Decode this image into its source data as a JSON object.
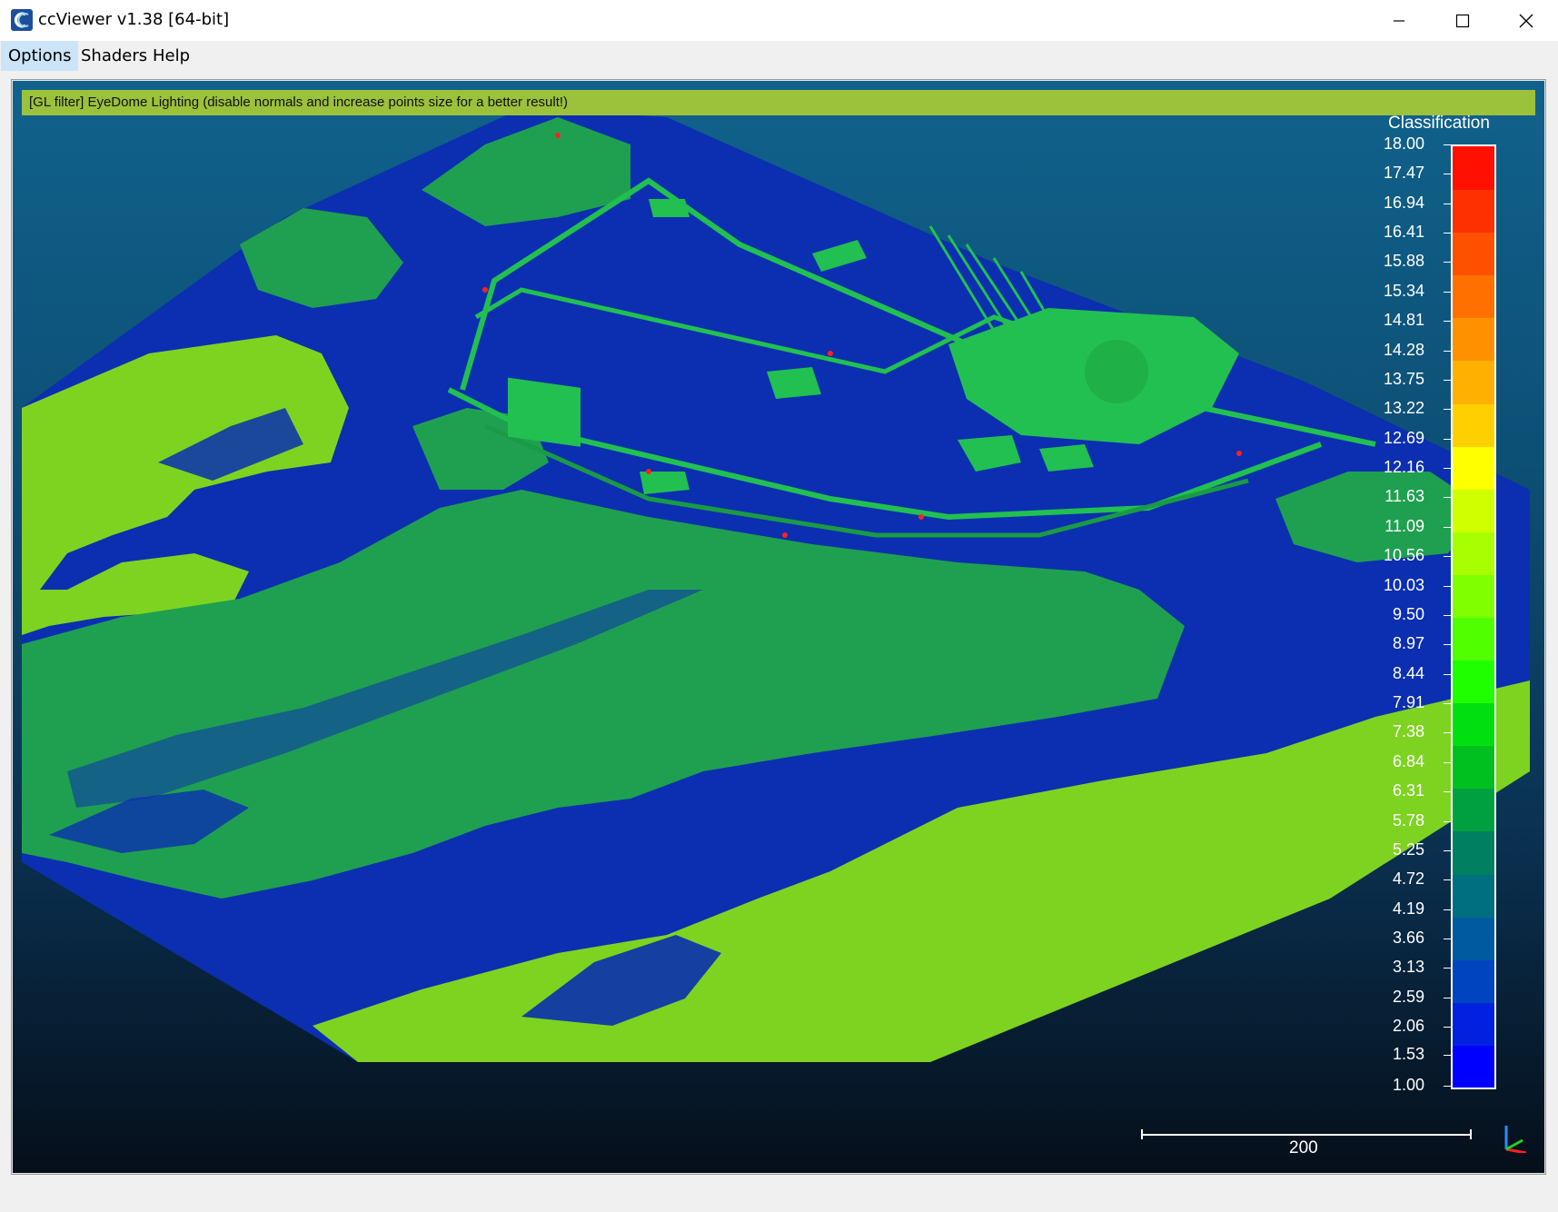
{
  "window": {
    "title": "ccViewer v1.38 [64-bit]",
    "app_icon": "cloudcompare-logo-icon"
  },
  "menu": {
    "items": [
      {
        "label": "Options",
        "active": true
      },
      {
        "label": "Shaders",
        "active": false
      },
      {
        "label": "Help",
        "active": false
      }
    ]
  },
  "viewport": {
    "filter_message": "[GL filter] EyeDome Lighting (disable normals and increase points size for a better result!)",
    "scalar_field": {
      "title": "Classification",
      "min": 1.0,
      "max": 18.0,
      "tick_labels": [
        "18.00",
        "17.47",
        "16.94",
        "16.41",
        "15.88",
        "15.34",
        "14.81",
        "14.28",
        "13.75",
        "13.22",
        "12.69",
        "12.16",
        "11.63",
        "11.09",
        "10.56",
        "10.03",
        "9.50",
        "8.97",
        "8.44",
        "7.91",
        "7.38",
        "6.84",
        "6.31",
        "5.78",
        "5.25",
        "4.72",
        "4.19",
        "3.66",
        "3.13",
        "2.59",
        "2.06",
        "1.53",
        "1.00"
      ],
      "band_colors": [
        "#0000ff",
        "#0022e0",
        "#0044c0",
        "#005aa0",
        "#006f80",
        "#008060",
        "#00a040",
        "#00c020",
        "#00e010",
        "#20ff00",
        "#50ff00",
        "#80ff00",
        "#a8ff00",
        "#d0ff00",
        "#ffff00",
        "#ffd000",
        "#ffb000",
        "#ff9000",
        "#ff7000",
        "#ff5000",
        "#ff3000",
        "#ff1000"
      ]
    },
    "scale_bar_label": "200",
    "colors": {
      "ground": "#7ed321",
      "low_vegetation": "#0b2fb0",
      "high_vegetation": "#1fa050",
      "building": "#22c050",
      "highlight": "#ff2020"
    }
  }
}
